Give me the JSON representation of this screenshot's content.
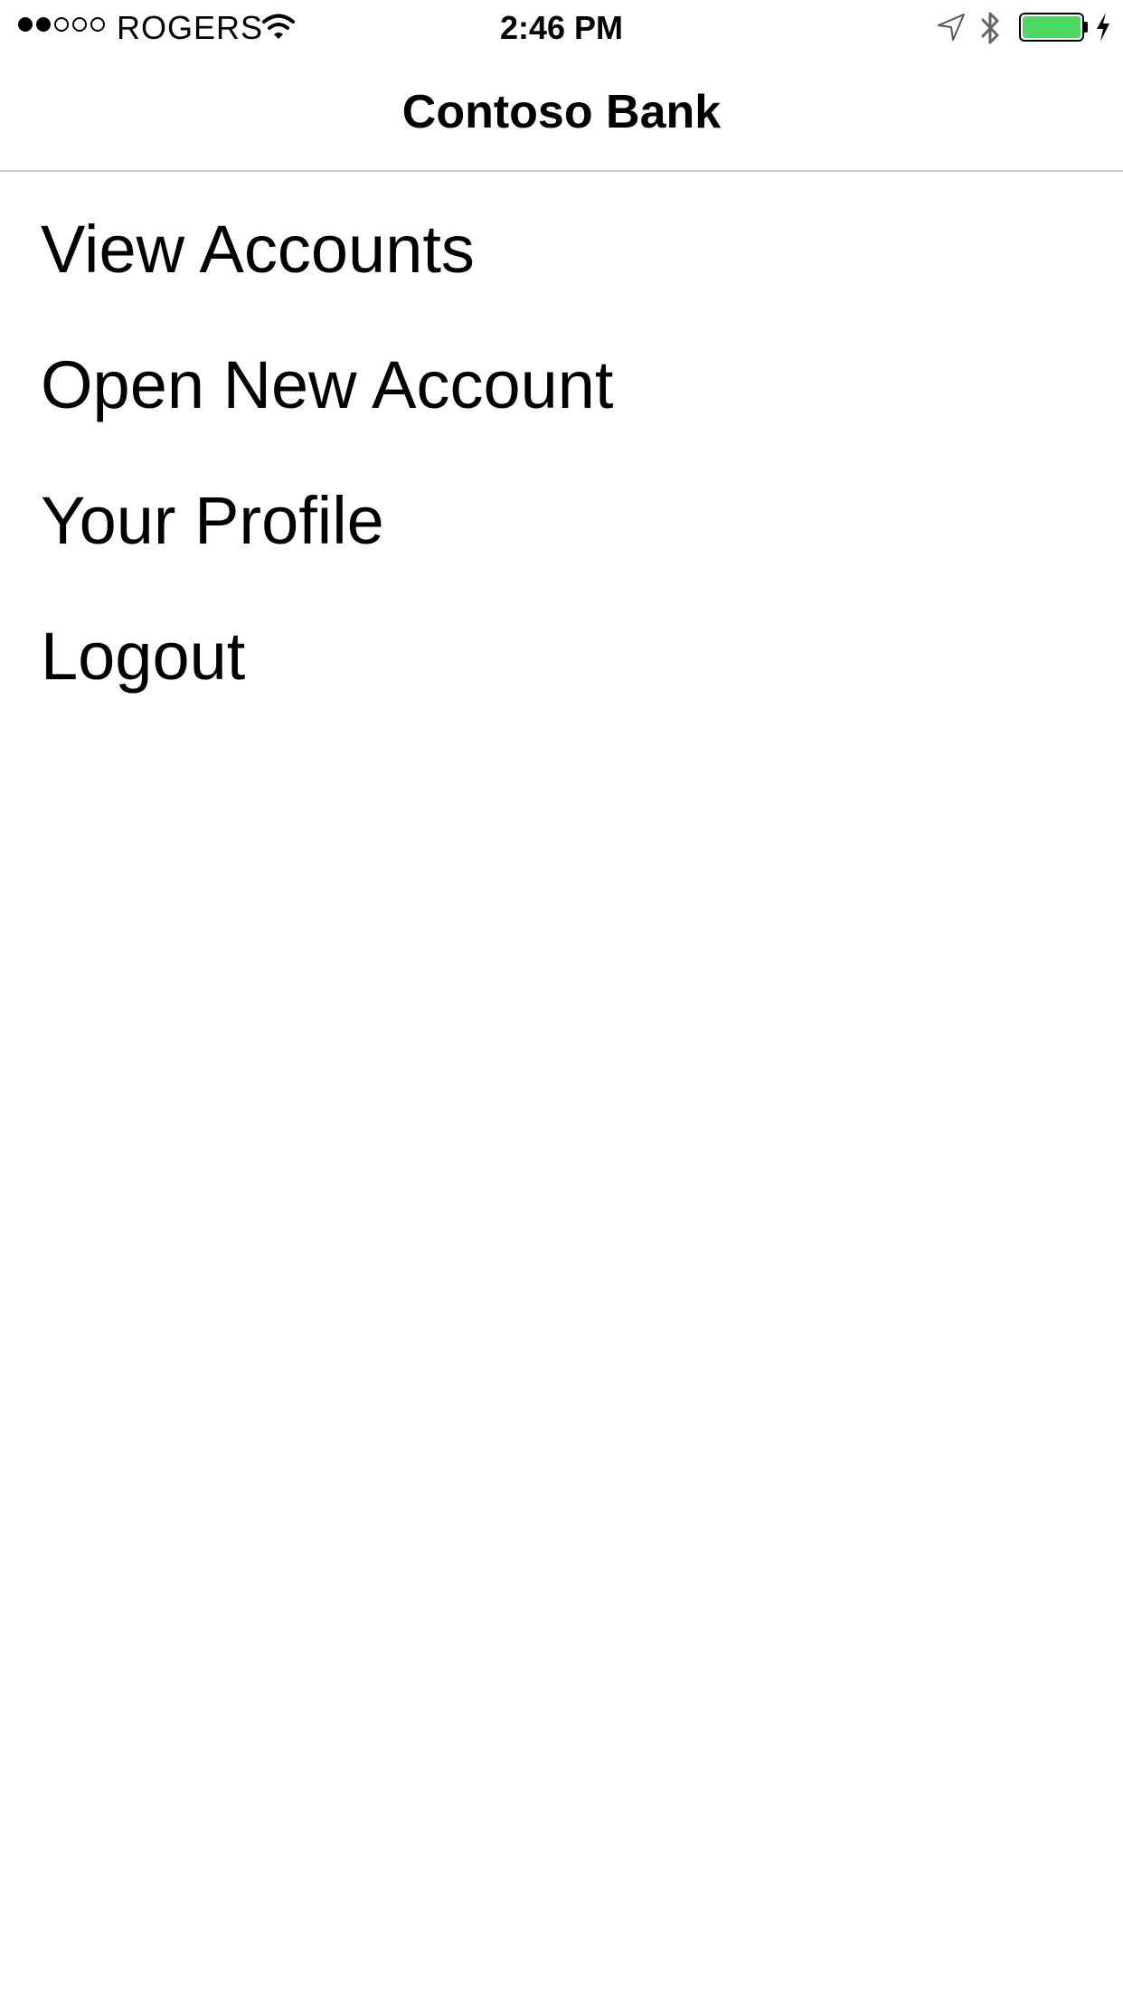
{
  "status_bar": {
    "signal_filled": 2,
    "signal_total": 5,
    "carrier": "ROGERS",
    "time": "2:46 PM",
    "icons": [
      "wifi-icon",
      "location-arrow-icon",
      "bluetooth-icon",
      "battery-icon",
      "charging-bolt-icon"
    ],
    "battery_level": 1.0,
    "battery_color": "#4cd964"
  },
  "nav": {
    "title": "Contoso Bank"
  },
  "menu": {
    "items": [
      {
        "label": "View Accounts"
      },
      {
        "label": "Open New Account"
      },
      {
        "label": "Your Profile"
      },
      {
        "label": "Logout"
      }
    ]
  }
}
